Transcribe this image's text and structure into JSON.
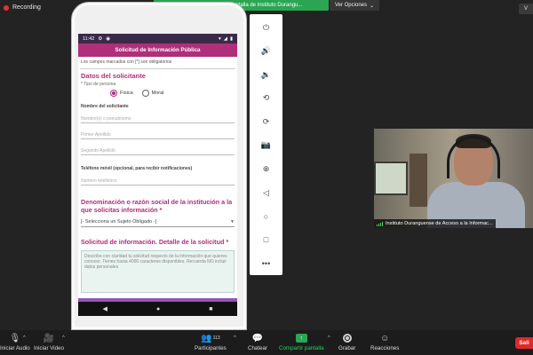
{
  "recording": {
    "label": "Recording"
  },
  "share_banner": {
    "text": "Usted está viendo la pantalla de Instituto Durangu..."
  },
  "view_options": {
    "label": "Ver Opciones",
    "caret": "⌄"
  },
  "top_right": {
    "label": "V"
  },
  "phone": {
    "status_time": "11:42",
    "app_title": "Solicitud de Información Pública",
    "required_note": "Los campos marcados con [*] son obligatorios",
    "section_applicant": "Datos del solicitante",
    "person_type_label": "* Tipo de persona",
    "radio_fisica": "Física",
    "radio_moral": "Moral",
    "applicant_name_label": "Nombre del solicitante",
    "placeholder_names": "Nombre(s) o pseudónimo",
    "placeholder_first_surname": "Primer Apellido",
    "placeholder_second_surname": "Segundo Apellido",
    "phone_label": "Teléfono móvil (opcional, para recibir notificaciones)",
    "placeholder_phone": "Número telefónico",
    "institution_title": "Denominación o razón social de la institución a la que solicitas información *",
    "institution_select": "[- Selecciona un Sujeto Obligado -]",
    "request_title": "Solicitud de información. Detalle de la solicitud *",
    "request_placeholder": "Describe con claridad tu solicitud respecto de la información que quieres conocer. Tienes hasta 4000 caracteres disponibles. Recuerda NO incluir datos personales",
    "nav_back": "◀",
    "nav_home": "●",
    "nav_recent": "■"
  },
  "emulator_toolbar": [
    {
      "name": "power-icon",
      "glyph": "⏻"
    },
    {
      "name": "volume-up-icon",
      "glyph": "🔊"
    },
    {
      "name": "volume-down-icon",
      "glyph": "🔉"
    },
    {
      "name": "rotate-left-icon",
      "glyph": "⟲"
    },
    {
      "name": "rotate-right-icon",
      "glyph": "⟳"
    },
    {
      "name": "camera-icon",
      "glyph": "📷"
    },
    {
      "name": "zoom-icon",
      "glyph": "⊕"
    },
    {
      "name": "back-icon",
      "glyph": "◁"
    },
    {
      "name": "home-icon",
      "glyph": "○"
    },
    {
      "name": "overview-icon",
      "glyph": "□"
    },
    {
      "name": "more-icon",
      "glyph": "•••"
    }
  ],
  "video_tile": {
    "participant_name": "Instituto Duranguense de Acceso a la Informac..."
  },
  "bottom_bar": {
    "audio_label": "Iniciar Audio",
    "video_label": "Iniciar Video",
    "participants_label": "Participantes",
    "participants_count": "113",
    "chat_label": "Chatear",
    "share_label": "Compartir pantalla",
    "record_label": "Grabar",
    "reactions_label": "Reacciones",
    "leave_label": "Sali"
  },
  "colors": {
    "accent": "#b02f7a",
    "share_green": "#2aa653",
    "leave_red": "#e02828"
  }
}
